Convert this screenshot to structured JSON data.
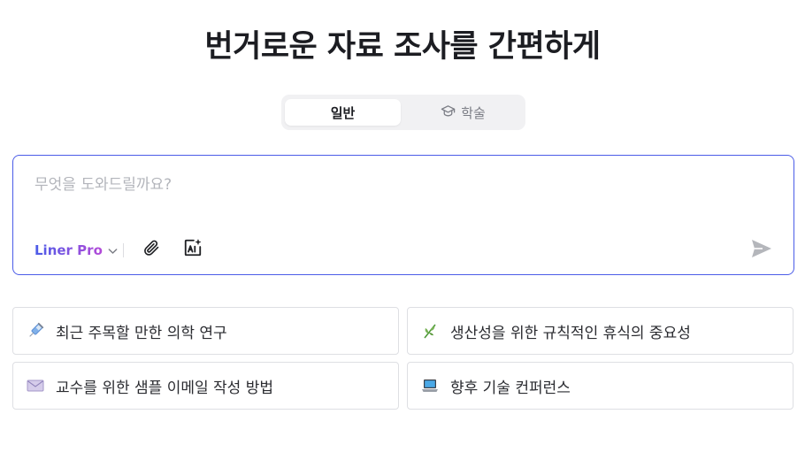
{
  "header": {
    "title": "번거로운 자료 조사를 간편하게"
  },
  "tabs": [
    {
      "label": "일반",
      "icon": "none",
      "selected": true
    },
    {
      "label": "학술",
      "icon": "graduation-cap-icon",
      "selected": false
    }
  ],
  "prompt": {
    "placeholder": "무엇을 도와드릴까요?",
    "value": "",
    "model_label": "Liner Pro",
    "accent_color": "#4b5ce8",
    "icons": [
      "paperclip-icon",
      "ai-tools-icon",
      "send-icon"
    ]
  },
  "suggestions": [
    {
      "icon": "syringe-icon",
      "text": "최근 주목할 만한 의학 연구"
    },
    {
      "icon": "herb-icon",
      "text": "생산성을 위한 규칙적인 휴식의 중요성"
    },
    {
      "icon": "envelope-icon",
      "text": "교수를 위한 샘플 이메일 작성 방법"
    },
    {
      "icon": "laptop-icon",
      "text": "향후 기술 컨퍼런스"
    }
  ]
}
